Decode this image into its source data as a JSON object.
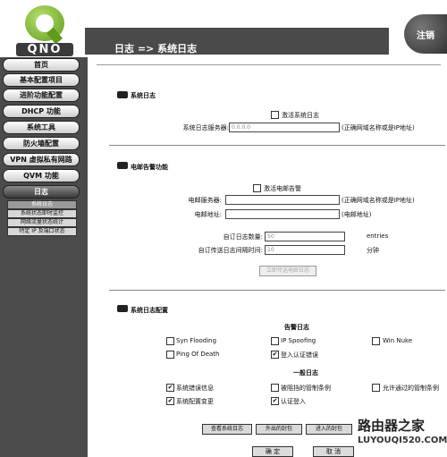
{
  "header": {
    "title": "日志 => 系统日志",
    "logout_label": "注销",
    "logo_text": "QNO"
  },
  "sidebar": {
    "items": [
      {
        "label": "首页"
      },
      {
        "label": "基本配置项目"
      },
      {
        "label": "进阶功能配置"
      },
      {
        "label": "DHCP 功能"
      },
      {
        "label": "系统工具"
      },
      {
        "label": "防火墙配置"
      },
      {
        "label": "VPN 虚拟私有网路"
      },
      {
        "label": "QVM 功能"
      },
      {
        "label": "日志"
      }
    ],
    "subitems": [
      {
        "label": "系统日志"
      },
      {
        "label": "系统状态即时监控"
      },
      {
        "label": "网络流量状态统计"
      },
      {
        "label": "特定 IP 及端口状态"
      }
    ]
  },
  "syslog": {
    "title": "系统日志",
    "enable_label": "激活系统日志",
    "server_label": "系统日志服务器:",
    "server_value": "0.0.0.0",
    "server_hint": "(正确网域名称或是IP地址)"
  },
  "email": {
    "title": "电邮告警功能",
    "enable_label": "激活电邮告警",
    "server_label": "电邮服务器:",
    "server_hint": "(正确网域名称或是IP地址)",
    "address_label": "电邮地址:",
    "address_hint": "(电邮地址)",
    "count_label": "自订日志数量:",
    "count_value": "50",
    "count_unit": "entries",
    "interval_label": "自订传送日志间隔时间:",
    "interval_value": "10",
    "interval_unit": "分钟",
    "send_now_label": "立即传送电邮日志"
  },
  "config": {
    "title": "系统日志配置",
    "alert_heading": "告警日志",
    "alert_items": [
      {
        "label": "Syn Flooding",
        "checked": false
      },
      {
        "label": "IP Spoofing",
        "checked": false
      },
      {
        "label": "Win Nuke",
        "checked": false
      },
      {
        "label": "Ping Of Death",
        "checked": false
      },
      {
        "label": "登入认证错误",
        "checked": true
      }
    ],
    "general_heading": "一般日志",
    "general_items": [
      {
        "label": "系统错误信息",
        "checked": true
      },
      {
        "label": "被阻挡的管制条例",
        "checked": false
      },
      {
        "label": "允许通过的管制条例",
        "checked": false
      },
      {
        "label": "系统配置变更",
        "checked": true
      },
      {
        "label": "认证登入",
        "checked": true
      }
    ],
    "view_buttons": [
      "查看系统日志",
      "外出的封包",
      "进入的封包"
    ]
  },
  "footer": {
    "ok_label": "确 定",
    "cancel_label": "取 消"
  },
  "watermark": {
    "line1": "路由器之家",
    "line2": "LUYOUQI520.COM"
  }
}
